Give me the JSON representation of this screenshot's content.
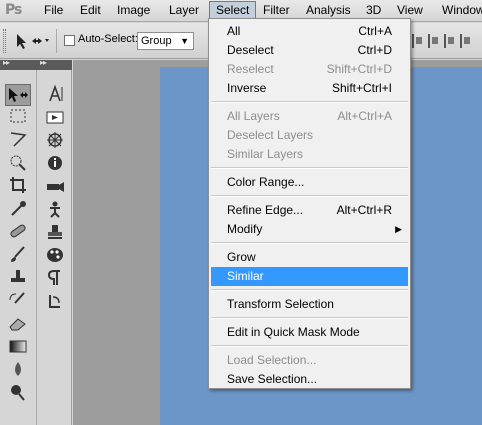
{
  "app": {
    "logo": "Ps"
  },
  "menubar": {
    "items": [
      "File",
      "Edit",
      "Image",
      "Layer",
      "Select",
      "Filter",
      "Analysis",
      "3D",
      "View",
      "Window"
    ]
  },
  "options": {
    "tool_preset_icon": "move-tool-icon",
    "auto_select_label": "Auto-Select:",
    "auto_select_checked": false,
    "auto_select_mode": "Group"
  },
  "tools": {
    "left_column": [
      "move",
      "marquee",
      "lasso",
      "quick-selection",
      "crop",
      "eyedropper",
      "spot-healing",
      "brush",
      "clone-stamp",
      "history-brush",
      "eraser",
      "gradient",
      "blur",
      "dodge"
    ],
    "right_column": [
      "type",
      "slide",
      "3d-rotate",
      "info",
      "3d-camera",
      "puppet",
      "stamp",
      "palette",
      "paragraph",
      "rotate"
    ]
  },
  "select_menu": {
    "all": {
      "label": "All",
      "shortcut": "Ctrl+A"
    },
    "deselect": {
      "label": "Deselect",
      "shortcut": "Ctrl+D"
    },
    "reselect": {
      "label": "Reselect",
      "shortcut": "Shift+Ctrl+D"
    },
    "inverse": {
      "label": "Inverse",
      "shortcut": "Shift+Ctrl+I"
    },
    "all_layers": {
      "label": "All Layers",
      "shortcut": "Alt+Ctrl+A"
    },
    "deselect_layers": {
      "label": "Deselect Layers"
    },
    "similar_layers": {
      "label": "Similar Layers"
    },
    "color_range": {
      "label": "Color Range..."
    },
    "refine_edge": {
      "label": "Refine Edge...",
      "shortcut": "Alt+Ctrl+R"
    },
    "modify": {
      "label": "Modify"
    },
    "grow": {
      "label": "Grow"
    },
    "similar": {
      "label": "Similar"
    },
    "transform_selection": {
      "label": "Transform Selection"
    },
    "quick_mask": {
      "label": "Edit in Quick Mask Mode"
    },
    "load_selection": {
      "label": "Load Selection..."
    },
    "save_selection": {
      "label": "Save Selection..."
    }
  },
  "colors": {
    "highlight": "#3399ff",
    "canvas": "#6c96c8",
    "disabled_text": "#8d8d8d"
  }
}
